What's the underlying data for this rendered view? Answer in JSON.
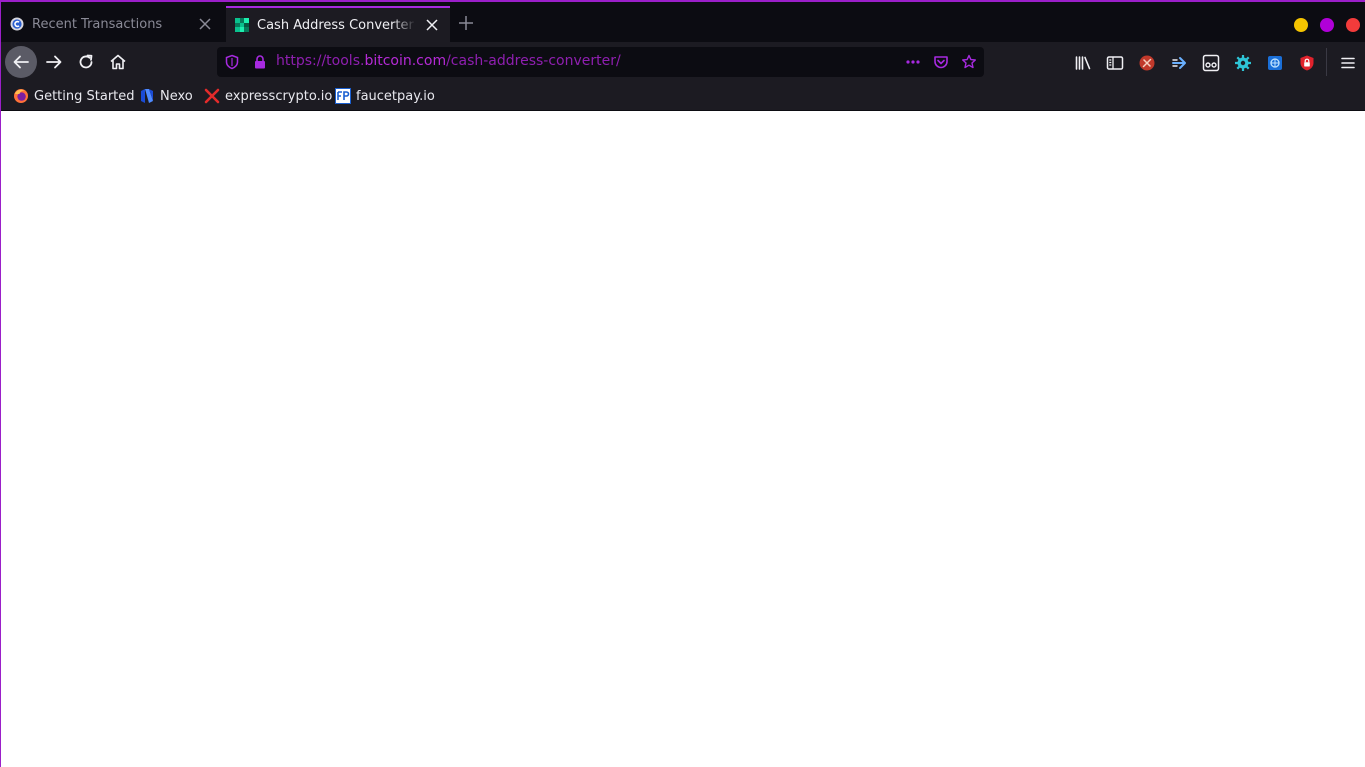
{
  "tabs": [
    {
      "title": "Recent Transactions",
      "active": false,
      "favicon": "blockchair-c-icon"
    },
    {
      "title": "Cash Address Converter | Tools",
      "active": true,
      "favicon": "bitcoin-tools-pixel-icon"
    }
  ],
  "window_controls": {
    "minimize_color": "#f5c400",
    "maximize_color": "#b000d8",
    "close_color": "#f23b3b"
  },
  "urlbar": {
    "url_prefix": "https://tools.",
    "url_domain": "bitcoin.com",
    "url_path": "/cash-address-converter/"
  },
  "bookmarks": [
    {
      "label": "Getting Started",
      "icon": "firefox-icon"
    },
    {
      "label": "Nexo",
      "icon": "nexo-icon"
    },
    {
      "label": "expresscrypto.io",
      "icon": "red-x-icon"
    },
    {
      "label": "faucetpay.io",
      "icon": "fp-icon"
    }
  ],
  "toolbar_icons": [
    "library-icon",
    "sidebar-icon",
    "extension-pickaxe-icon",
    "extension-arrow-icon",
    "extension-glasses-icon",
    "extension-gear-icon",
    "extension-shield-blue-icon",
    "extension-lock-red-icon",
    "menu-icon"
  ],
  "accent_color": "#a72ae0"
}
